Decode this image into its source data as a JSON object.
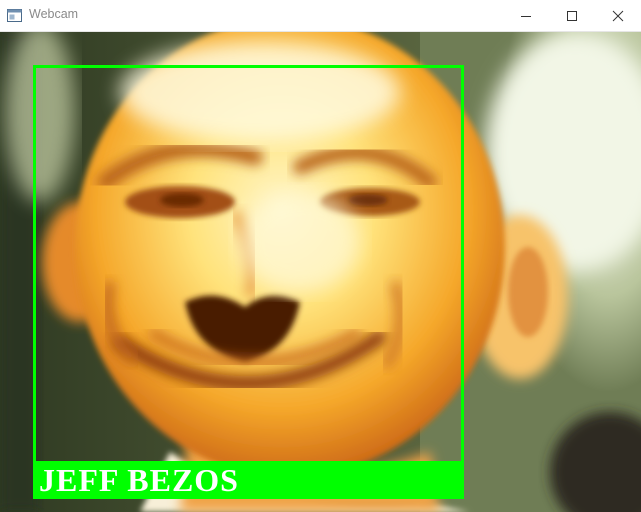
{
  "window": {
    "title": "Webcam",
    "app_icon": "window-app-icon",
    "controls": [
      "minimize-icon",
      "maximize-icon",
      "close-icon"
    ]
  },
  "detection": {
    "label": "JEFF BEZOS",
    "box_color": "#00ff00",
    "label_color": "#ffffff"
  }
}
